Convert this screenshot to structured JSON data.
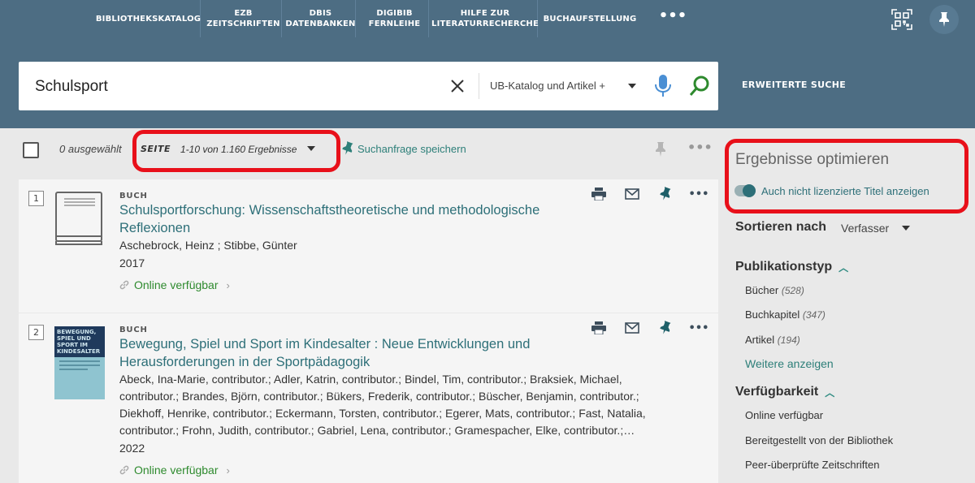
{
  "nav": {
    "items": [
      {
        "label": "BIBLIOTHEKSKATALOG"
      },
      {
        "label": "EZB\nZEITSCHRIFTEN"
      },
      {
        "label": "DBIS\nDATENBANKEN"
      },
      {
        "label": "DIGIBIB\nFERNLEIHE"
      },
      {
        "label": "HILFE ZUR\nLITERATURRECHERCHE"
      },
      {
        "label": "BUCHAUFSTELLUNG"
      }
    ],
    "more": "•••"
  },
  "search": {
    "query": "Schulsport",
    "scope": "UB-Katalog und Artikel +",
    "advanced": "ERWEITERTE SUCHE"
  },
  "toolbar": {
    "selected": "0 ausgewählt",
    "page_label": "SEITE",
    "page_range": "1-10 von 1.160 Ergebnisse",
    "save_query": "Suchanfrage speichern",
    "more": "•••"
  },
  "results": [
    {
      "num": "1",
      "type": "BUCH",
      "title": "Schulsportforschung: Wissenschaftstheoretische und methodologische Reflexionen",
      "authors": "Aschebrock, Heinz ; Stibbe, Günter",
      "year": "2017",
      "availability": "Online verfügbar"
    },
    {
      "num": "2",
      "type": "BUCH",
      "title": "Bewegung, Spiel und Sport im Kindesalter : Neue Entwicklungen und Herausforderungen in der Sportpädagogik",
      "authors": "Abeck, Ina-Marie, contributor.; Adler, Katrin, contributor.; Bindel, Tim, contributor.; Braksiek, Michael, contributor.; Brandes, Björn, contributor.; Bükers, Frederik, contributor.; Büscher, Benjamin, contributor.; Diekhoff, Henrike, contributor.; Eckermann, Torsten, contributor.; Egerer, Mats, contributor.; Fast, Natalia, contributor.; Frohn, Judith, contributor.; Gabriel, Lena, contributor.; Gramespacher, Elke, contributor.;…",
      "year": "2022",
      "availability": "Online verfügbar",
      "cover_title": "BEWEGUNG, SPIEL UND SPORT IM KINDESALTER"
    }
  ],
  "sidebar": {
    "title": "Ergebnisse optimieren",
    "toggle_label": "Auch nicht lizenzierte Titel anzeigen",
    "sort_label": "Sortieren nach",
    "sort_value": "Verfasser",
    "facets": [
      {
        "head": "Publikationstyp",
        "items": [
          {
            "label": "Bücher",
            "count": "(528)"
          },
          {
            "label": "Buchkapitel",
            "count": "(347)"
          },
          {
            "label": "Artikel",
            "count": "(194)"
          }
        ],
        "more": "Weitere anzeigen"
      },
      {
        "head": "Verfügbarkeit",
        "items": [
          {
            "label": "Online verfügbar"
          },
          {
            "label": "Bereitgestellt von der Bibliothek"
          },
          {
            "label": "Peer-überprüfte Zeitschriften"
          }
        ]
      }
    ]
  },
  "colors": {
    "header_bg": "#4d6d83",
    "accent_teal": "#2d6f78",
    "available_green": "#2e8a2e",
    "highlight_red": "#e8101a"
  }
}
